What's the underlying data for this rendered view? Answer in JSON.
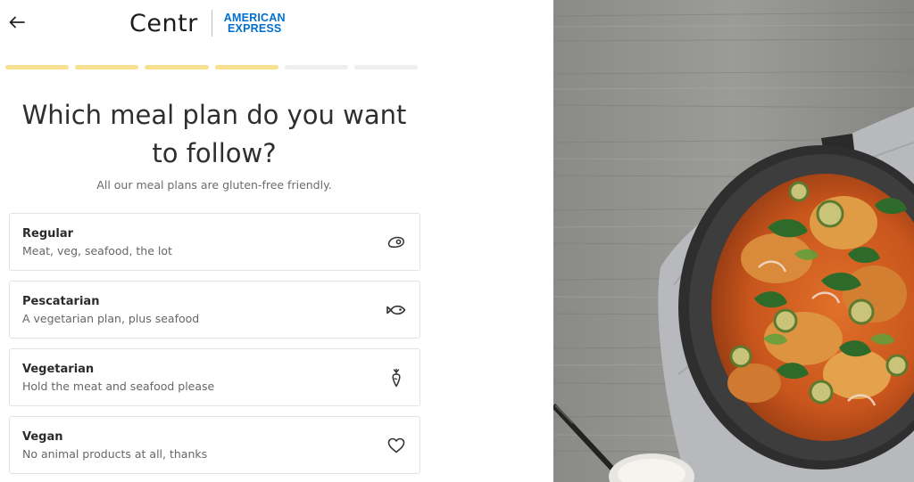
{
  "header": {
    "back_icon": "arrow-left-icon",
    "brand_left": "Centr",
    "brand_right_line1": "AMERICAN",
    "brand_right_line2": "EXPRESS",
    "brand_right_color": "#006fcf"
  },
  "progress": {
    "total_steps": 6,
    "completed_steps": 4,
    "active_color": "#f8e08e",
    "inactive_color": "#eeeeee"
  },
  "page": {
    "title": "Which meal plan do you want to follow?",
    "subtitle": "All our meal plans are gluten-free friendly."
  },
  "options": [
    {
      "title": "Regular",
      "description": "Meat, veg, seafood, the lot",
      "icon": "steak-icon"
    },
    {
      "title": "Pescatarian",
      "description": "A vegetarian plan, plus seafood",
      "icon": "fish-icon"
    },
    {
      "title": "Vegetarian",
      "description": "Hold the meat and seafood please",
      "icon": "carrot-icon"
    },
    {
      "title": "Vegan",
      "description": "No animal products at all, thanks",
      "icon": "heart-icon"
    }
  ],
  "hero_image": {
    "subject": "food-photo"
  }
}
